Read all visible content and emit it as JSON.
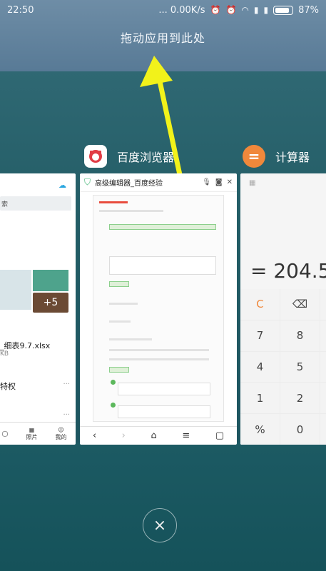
{
  "status_bar": {
    "time": "22:50",
    "network_speed": "... 0.00K/s",
    "battery_percent": "87%",
    "battery_level": 0.87
  },
  "drag_hint": "拖动应用到此处",
  "apps": [
    {
      "name": "百度浏览器",
      "icon": "baidu-browser-icon",
      "tab_title": "高级编辑器_百度经验"
    },
    {
      "name": "计算器",
      "icon": "calculator-icon",
      "display": "= 204.5",
      "keys": [
        "C",
        "⌫",
        "7",
        "8",
        "4",
        "5",
        "1",
        "2",
        "%",
        "0"
      ]
    }
  ],
  "left_card": {
    "search_text": "索",
    "badge": "+5",
    "file_name": "_细表9.7.xlsx",
    "file_meta": "KB",
    "item_text": "特权",
    "tabs": [
      "照片",
      "我的"
    ]
  },
  "close_button": "×",
  "colors": {
    "accent_orange": "#f0883b",
    "arrow_yellow": "#f2f21a"
  }
}
